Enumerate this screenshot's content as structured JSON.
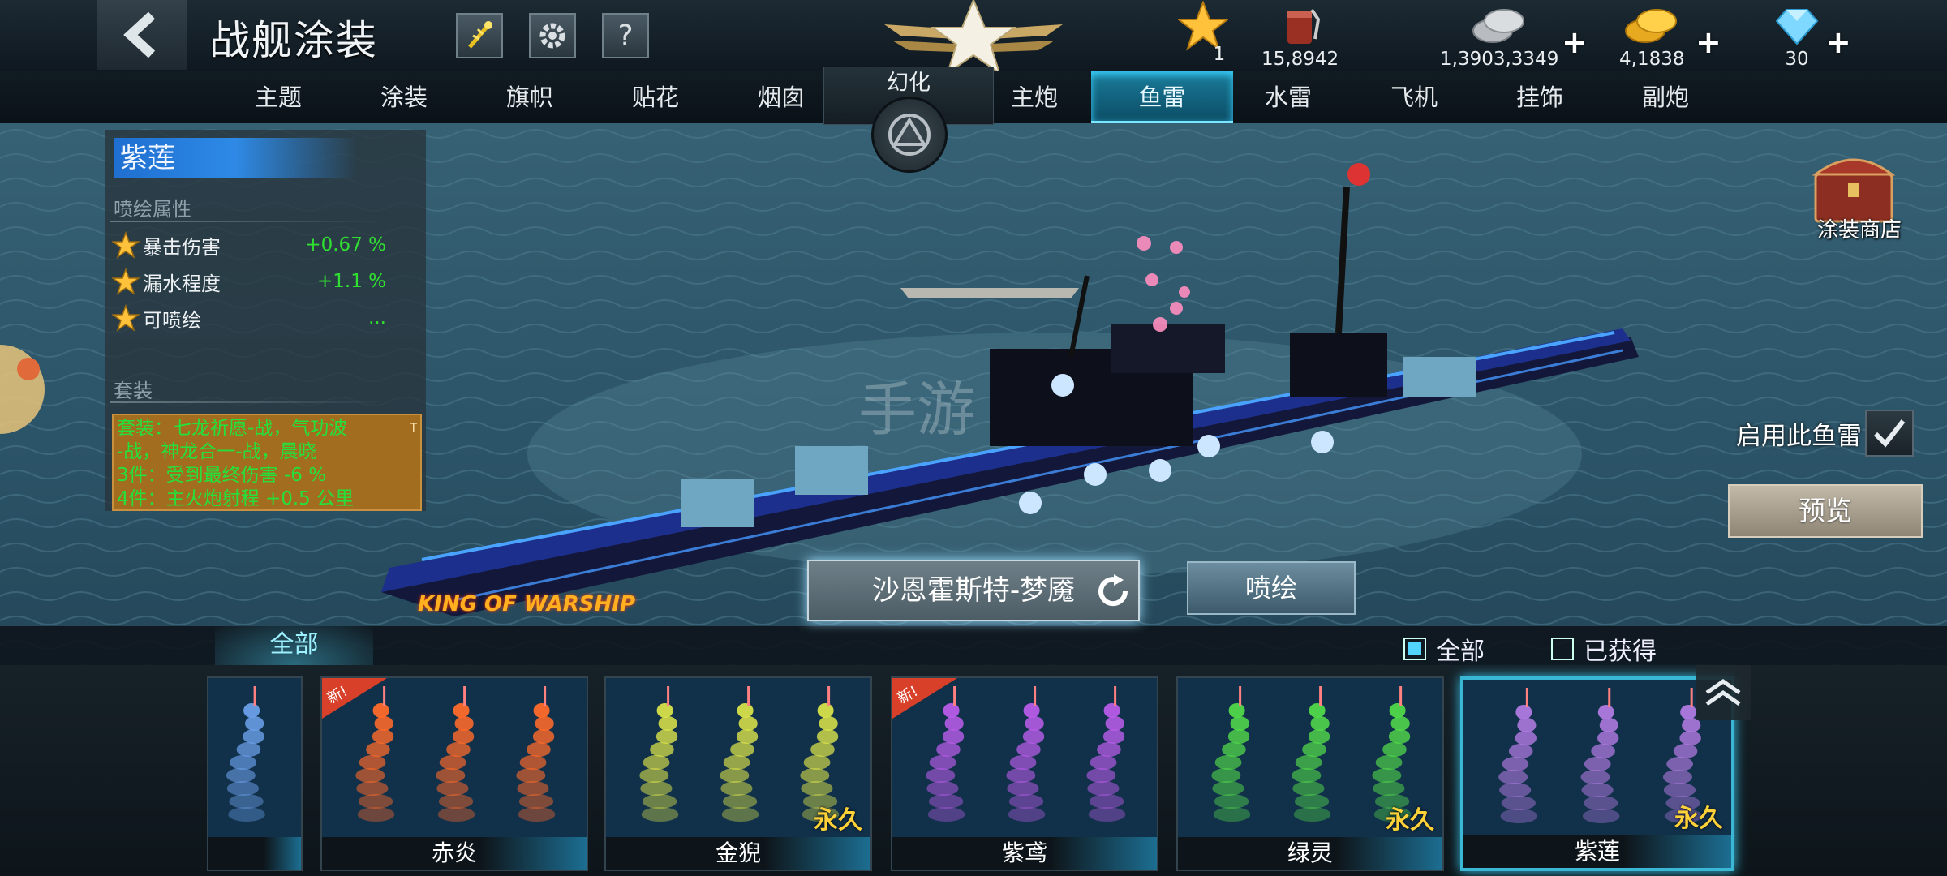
{
  "header": {
    "title": "战舰涂装",
    "icons": [
      "back-arrow-icon",
      "firework-icon",
      "gear-icon",
      "help-icon"
    ],
    "help_label": "?"
  },
  "currencies": [
    {
      "id": "star",
      "value": "1",
      "icon": "star-icon",
      "has_plus": false
    },
    {
      "id": "paint",
      "value": "15,8942",
      "icon": "paint-bucket-icon",
      "has_plus": false
    },
    {
      "id": "silver",
      "value": "1,3903,3349",
      "icon": "silver-coin-icon",
      "has_plus": true
    },
    {
      "id": "gold",
      "value": "4,1838",
      "icon": "gold-coin-icon",
      "has_plus": true
    },
    {
      "id": "diamond",
      "value": "30",
      "icon": "diamond-icon",
      "has_plus": true
    }
  ],
  "tabs": [
    {
      "label": "主题"
    },
    {
      "label": "涂装"
    },
    {
      "label": "旗帜"
    },
    {
      "label": "贴花"
    },
    {
      "label": "烟囱"
    },
    {
      "label": "主炮"
    },
    {
      "label": "鱼雷",
      "active": true
    },
    {
      "label": "水雷"
    },
    {
      "label": "飞机"
    },
    {
      "label": "挂饰"
    },
    {
      "label": "副炮"
    }
  ],
  "huanhua_label": "幻化",
  "info": {
    "name": "紫莲",
    "section_title": "喷绘属性",
    "attributes": [
      {
        "name": "暴击伤害",
        "value": "+0.67 %"
      },
      {
        "name": "漏水程度",
        "value": "+1.1 %"
      },
      {
        "name": "可喷绘",
        "value": "..."
      }
    ],
    "set_title": "套装",
    "set_lines": [
      "套装：七龙祈愿-战，气功波",
      "-战，神龙合一-战，晨晓",
      "3件：受到最终伤害 -6 %",
      "4件：主火炮射程 +0.5 公里"
    ],
    "set_tag": "T"
  },
  "shop_label": "涂装商店",
  "enable_label": "启用此鱼雷",
  "preview_label": "预览",
  "ship_name": "沙恩霍斯特-梦魇",
  "paint_label": "喷绘",
  "watermark": "KING OF WARSHIP",
  "filter": {
    "tab": "全部",
    "option_all": "全部",
    "option_owned": "已获得",
    "all_checked": true
  },
  "cards": [
    {
      "name": "",
      "color": "#6a9fe8",
      "permanent": "",
      "is_new": false,
      "partial": true
    },
    {
      "name": "赤炎",
      "color": "#ff6a2a",
      "permanent": "",
      "is_new": true
    },
    {
      "name": "金猊",
      "color": "#d8e04a",
      "permanent": "永久",
      "is_new": false
    },
    {
      "name": "紫鸢",
      "color": "#b85ce8",
      "permanent": "",
      "is_new": true
    },
    {
      "name": "绿灵",
      "color": "#52d84a",
      "permanent": "永久",
      "is_new": false
    },
    {
      "name": "紫莲",
      "color": "#b07ae0",
      "permanent": "永久",
      "is_new": false,
      "selected": true
    }
  ],
  "new_label": "新!",
  "colors": {
    "active_tab": "#1a7c9a",
    "attr_value": "#30e030",
    "set_text": "#26e03a",
    "set_bg": "#a36d1f",
    "permanent": "#ffd23a",
    "sea": "#2c5468"
  }
}
